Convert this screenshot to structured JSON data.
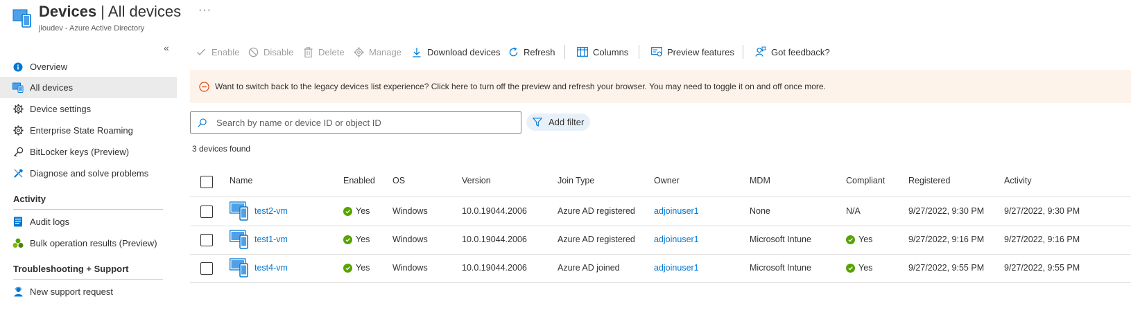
{
  "header": {
    "title_main": "Devices",
    "title_sep": " | ",
    "title_sub": "All devices",
    "subtitle": "jloudev - Azure Active Directory",
    "more": "···"
  },
  "sidebar": {
    "collapse": "«",
    "items": [
      {
        "label": "Overview",
        "icon": "info-icon"
      },
      {
        "label": "All devices",
        "icon": "devices-icon"
      },
      {
        "label": "Device settings",
        "icon": "gear-icon"
      },
      {
        "label": "Enterprise State Roaming",
        "icon": "gear-icon"
      },
      {
        "label": "BitLocker keys (Preview)",
        "icon": "key-icon"
      },
      {
        "label": "Diagnose and solve problems",
        "icon": "wrench-icon"
      }
    ],
    "section_activity": "Activity",
    "activity_items": [
      {
        "label": "Audit logs",
        "icon": "audit-log-icon"
      },
      {
        "label": "Bulk operation results (Preview)",
        "icon": "bulk-operation-icon"
      }
    ],
    "section_support": "Troubleshooting + Support",
    "support_items": [
      {
        "label": "New support request",
        "icon": "support-person-icon"
      }
    ]
  },
  "toolbar": {
    "enable": "Enable",
    "disable": "Disable",
    "delete": "Delete",
    "manage": "Manage",
    "download": "Download devices",
    "refresh": "Refresh",
    "columns": "Columns",
    "preview": "Preview features",
    "feedback": "Got feedback?"
  },
  "banner": {
    "text": "Want to switch back to the legacy devices list experience? Click here to turn off the preview and refresh your browser. You may need to toggle it on and off once more."
  },
  "search": {
    "placeholder": "Search by name or device ID or object ID"
  },
  "filter": {
    "label": "Add filter"
  },
  "result_count": "3 devices found",
  "table": {
    "columns": [
      "Name",
      "Enabled",
      "OS",
      "Version",
      "Join Type",
      "Owner",
      "MDM",
      "Compliant",
      "Registered",
      "Activity"
    ],
    "rows": [
      {
        "name": "test2-vm",
        "enabled": "Yes",
        "os": "Windows",
        "version": "10.0.19044.2006",
        "join_type": "Azure AD registered",
        "owner": "adjoinuser1",
        "mdm": "None",
        "compliant": "N/A",
        "compliant_check": false,
        "registered": "9/27/2022, 9:30 PM",
        "activity": "9/27/2022, 9:30 PM"
      },
      {
        "name": "test1-vm",
        "enabled": "Yes",
        "os": "Windows",
        "version": "10.0.19044.2006",
        "join_type": "Azure AD registered",
        "owner": "adjoinuser1",
        "mdm": "Microsoft Intune",
        "compliant": "Yes",
        "compliant_check": true,
        "registered": "9/27/2022, 9:16 PM",
        "activity": "9/27/2022, 9:16 PM"
      },
      {
        "name": "test4-vm",
        "enabled": "Yes",
        "os": "Windows",
        "version": "10.0.19044.2006",
        "join_type": "Azure AD joined",
        "owner": "adjoinuser1",
        "mdm": "Microsoft Intune",
        "compliant": "Yes",
        "compliant_check": true,
        "registered": "9/27/2022, 9:55 PM",
        "activity": "9/27/2022, 9:55 PM"
      }
    ]
  },
  "colors": {
    "accent": "#0078d4",
    "success": "#57a300",
    "banner_bg": "#fdf3ea",
    "banner_icon": "#d83b01",
    "active_nav": "#ebebeb"
  }
}
